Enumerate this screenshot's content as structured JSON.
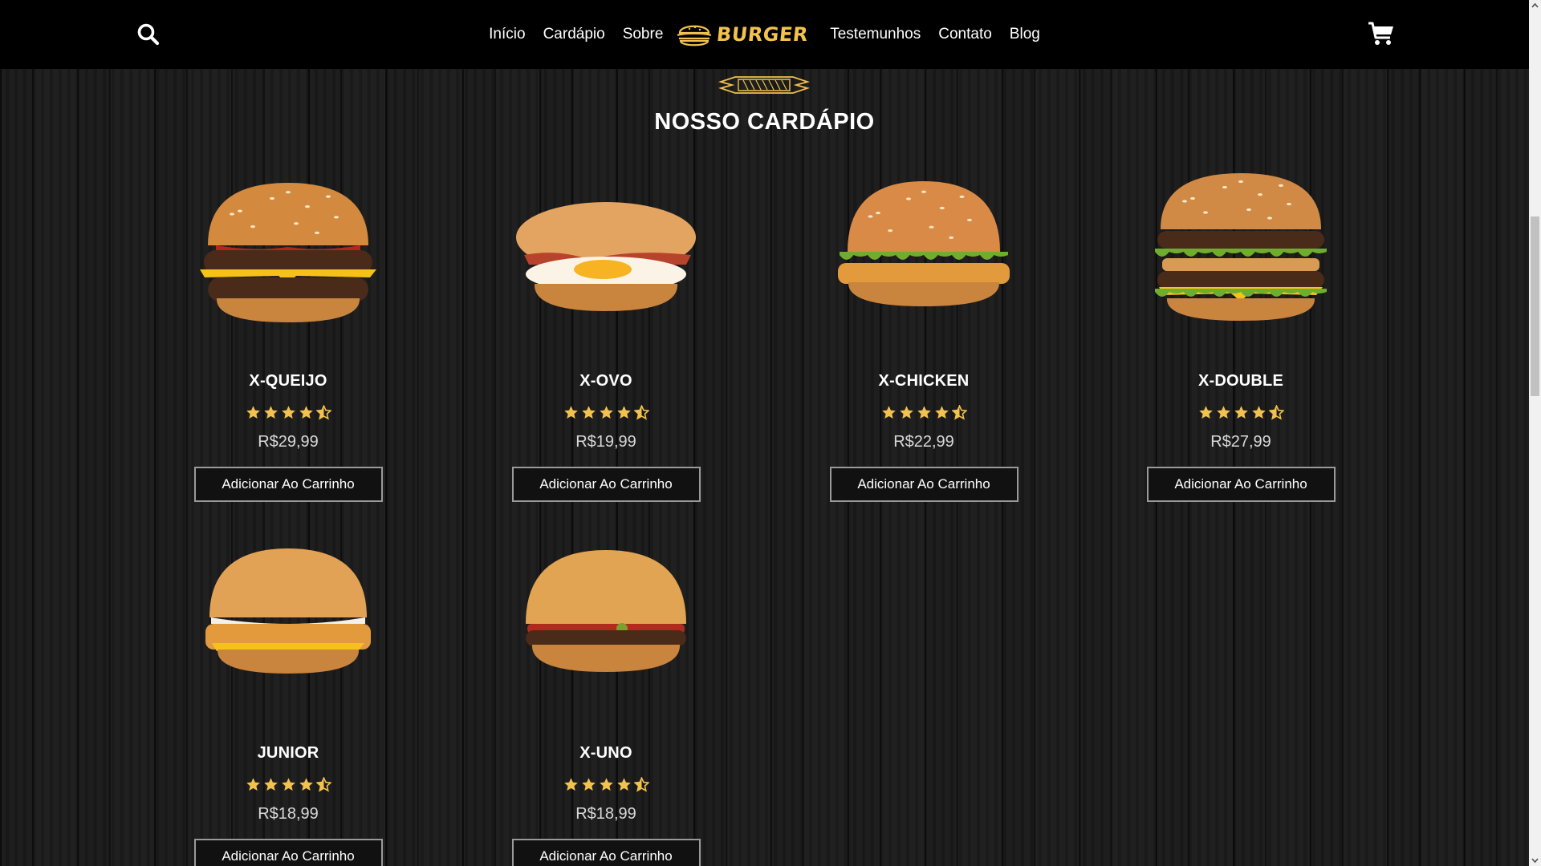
{
  "nav": {
    "items": [
      "Início",
      "Cardápio",
      "Sobre"
    ],
    "items_right": [
      "Testemunhos",
      "Contato",
      "Blog"
    ],
    "logo_text": "BURGER"
  },
  "icons": {
    "search": "search-icon",
    "cart": "shopping-cart-icon",
    "logo": "burger-logo-icon",
    "star": "star-icon",
    "half_star": "half-star-icon"
  },
  "section": {
    "title": "NOSSO CARDÁPIO"
  },
  "colors": {
    "accent": "#f2c14e",
    "header_bg": "#000000",
    "page_bg": "#151515",
    "button_border": "#9a9a9a"
  },
  "products": [
    {
      "name": "X-QUEIJO",
      "price": "R$29,99",
      "rating": 4.5,
      "button": "Adicionar Ao Carrinho"
    },
    {
      "name": "X-OVO",
      "price": "R$19,99",
      "rating": 4.5,
      "button": "Adicionar Ao Carrinho"
    },
    {
      "name": "X-CHICKEN",
      "price": "R$22,99",
      "rating": 4.5,
      "button": "Adicionar Ao Carrinho"
    },
    {
      "name": "X-DOUBLE",
      "price": "R$27,99",
      "rating": 4.5,
      "button": "Adicionar Ao Carrinho"
    },
    {
      "name": "JUNIOR",
      "price": "R$18,99",
      "rating": 4.5,
      "button": "Adicionar Ao Carrinho"
    },
    {
      "name": "X-UNO",
      "price": "R$18,99",
      "rating": 4.5,
      "button": "Adicionar Ao Carrinho"
    }
  ]
}
